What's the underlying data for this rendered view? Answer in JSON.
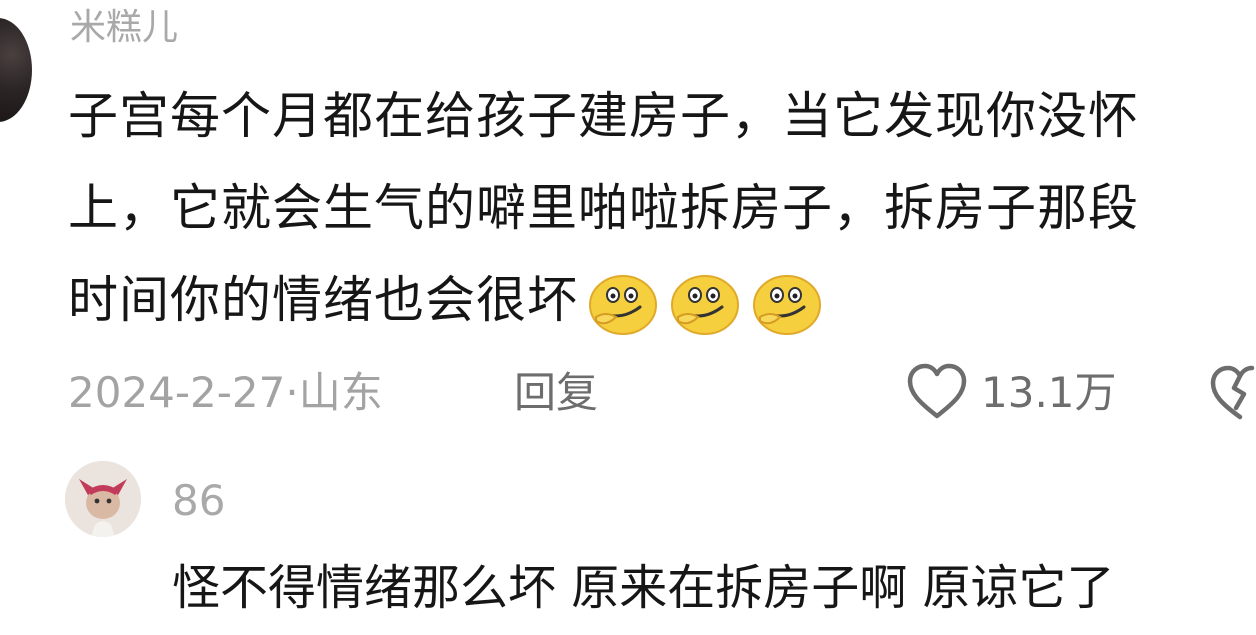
{
  "comment": {
    "username": "米糕儿",
    "lines": [
      "子宫每个月都在给孩子建房子，当它发现你没怀",
      "上，它就会生气的噼里啪啦拆房子，拆房子那段",
      "时间你的情绪也会很坏"
    ],
    "emojis": [
      "smirk-emoji",
      "smirk-emoji",
      "smirk-emoji"
    ],
    "date_location": "2024-2-27·山东",
    "reply_label": "回复",
    "likes": "13.1万"
  },
  "reply": {
    "username": "86",
    "text": "怪不得情绪那么坏 原来在拆房子啊 原谅它了"
  },
  "icons": {
    "like": "heart-outline-icon",
    "dislike": "broken-heart-icon"
  },
  "colors": {
    "text": "#161616",
    "muted": "#a9a9a9",
    "secondary": "#6d6d6d",
    "emoji": "#f5cf3d"
  }
}
